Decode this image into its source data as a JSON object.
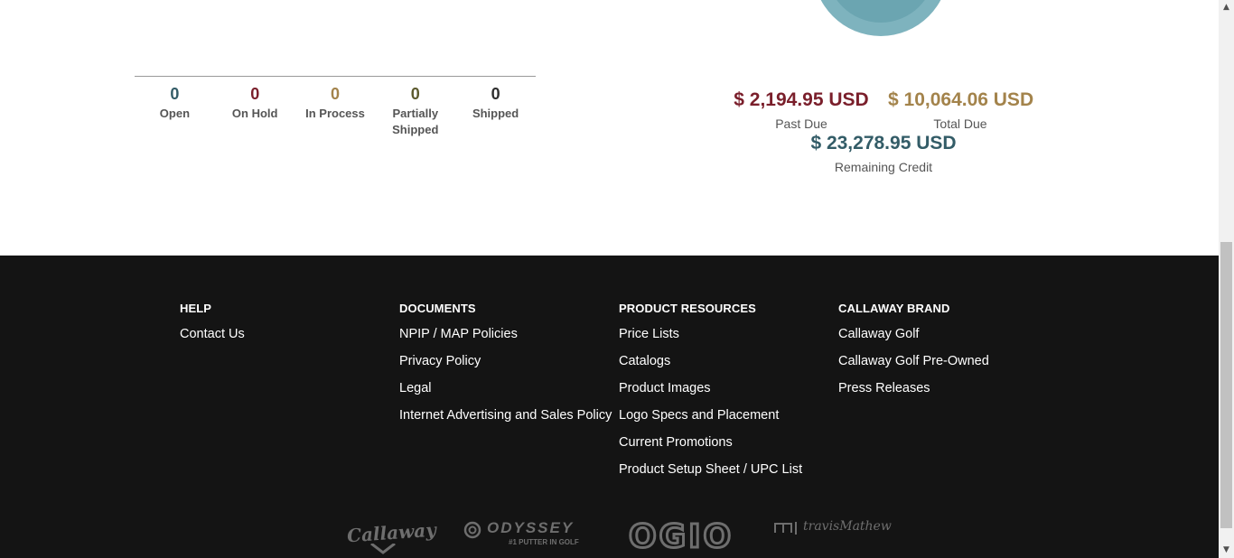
{
  "colors": {
    "footer_bg": "#141414",
    "open": "#335c67",
    "on_hold": "#7a1f2b",
    "in_process": "#a3834b",
    "partially_shipped": "#5c5a2e",
    "shipped": "#2e2e2e",
    "past_due": "#7a1f2b",
    "total_due": "#a3834b",
    "remaining_credit": "#335c67"
  },
  "order_status": [
    {
      "count": "0",
      "label": "Open",
      "color": "#335c67"
    },
    {
      "count": "0",
      "label": "On Hold",
      "color": "#7a1f2b"
    },
    {
      "count": "0",
      "label": "In Process",
      "color": "#a3834b"
    },
    {
      "count": "0",
      "label": "Partially Shipped",
      "color": "#5c5a2e"
    },
    {
      "count": "0",
      "label": "Shipped",
      "color": "#2e2e2e"
    }
  ],
  "account": {
    "past_due": {
      "value": "$ 2,194.95 USD",
      "label": "Past Due"
    },
    "total_due": {
      "value": "$ 10,064.06 USD",
      "label": "Total Due"
    },
    "remaining_credit": {
      "value": "$ 23,278.95 USD",
      "label": "Remaining Credit"
    }
  },
  "footer": {
    "help": {
      "title": "HELP",
      "links": [
        "Contact Us"
      ]
    },
    "documents": {
      "title": "DOCUMENTS",
      "links": [
        "NPIP / MAP Policies",
        "Privacy Policy",
        "Legal",
        "Internet Advertising and Sales Policy"
      ]
    },
    "product_resources": {
      "title": "PRODUCT RESOURCES",
      "links": [
        "Price Lists",
        "Catalogs",
        "Product Images",
        "Logo Specs and Placement",
        "Current Promotions",
        "Product Setup Sheet / UPC List"
      ]
    },
    "callaway_brand": {
      "title": "CALLAWAY BRAND",
      "links": [
        "Callaway Golf",
        "Callaway Golf Pre-Owned",
        "Press Releases"
      ]
    }
  },
  "brands": {
    "callaway": "Callaway",
    "odyssey": "ODYSSEY",
    "odyssey_tagline": "#1 PUTTER IN GOLF",
    "ogio": "OGIO",
    "travismathew": "travisMathew"
  }
}
